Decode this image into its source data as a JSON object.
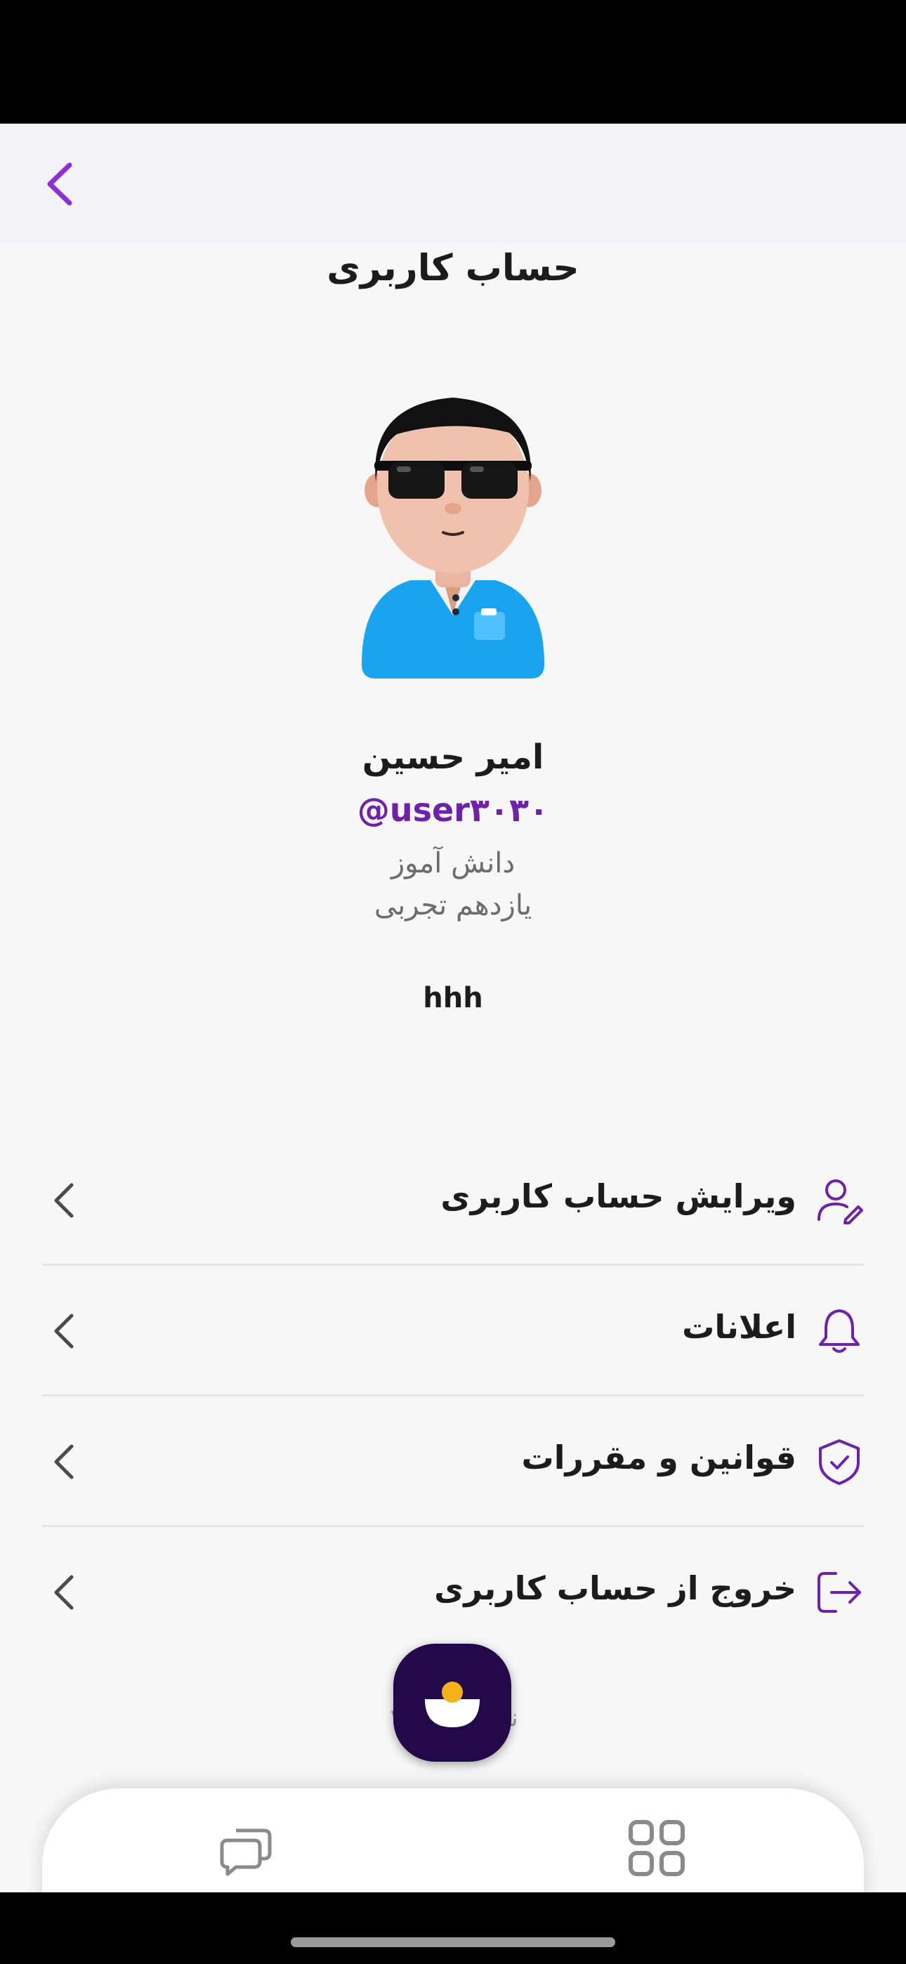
{
  "header": {
    "title": "حساب کاربری",
    "back_icon": "chevron-left-icon"
  },
  "profile": {
    "name": "امیر حسین",
    "username": "@user۳۰۳۰",
    "role": "دانش آموز",
    "grade": "یازدهم تجربی",
    "bio": "hhh",
    "avatar": "3d-avatar-man-sunglasses"
  },
  "menu": {
    "items": [
      {
        "label": "ویرایش حساب کاربری",
        "icon": "user-edit-icon"
      },
      {
        "label": "اعلانات",
        "icon": "bell-icon"
      },
      {
        "label": "قوانین و مقررات",
        "icon": "shield-check-icon"
      },
      {
        "label": "خروج از حساب کاربری",
        "icon": "logout-icon"
      }
    ]
  },
  "footer": {
    "version": "نسخه ۱.۰.۲۰"
  },
  "bottom_nav": {
    "items": [
      "chat-icon",
      "home-icon",
      "grid-icon"
    ]
  },
  "colors": {
    "accent": "#6f22a8",
    "nav_center": "#24094a",
    "home_dot": "#f3b21a",
    "background": "#f7f7f8"
  }
}
